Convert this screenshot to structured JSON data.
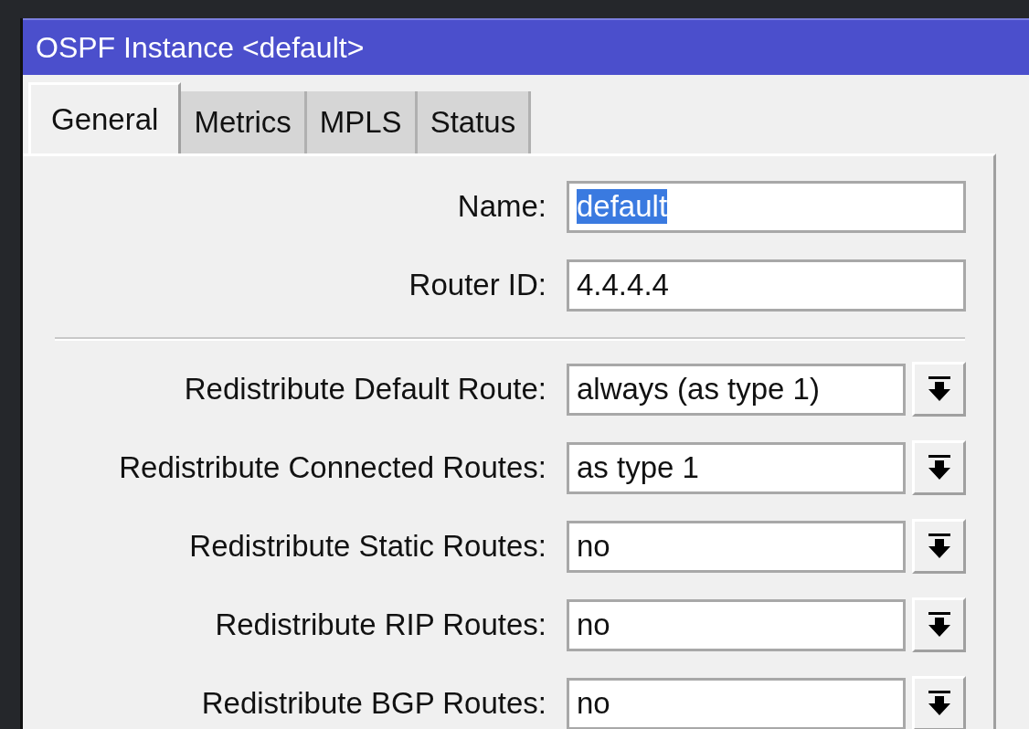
{
  "window": {
    "title": "OSPF Instance <default>"
  },
  "tabs": [
    {
      "label": "General",
      "selected": true
    },
    {
      "label": "Metrics",
      "selected": false
    },
    {
      "label": "MPLS",
      "selected": false
    },
    {
      "label": "Status",
      "selected": false
    }
  ],
  "field_groups": [
    [
      {
        "kind": "text",
        "label": "Name:",
        "value": "default",
        "highlighted": true
      },
      {
        "kind": "text",
        "label": "Router ID:",
        "value": "4.4.4.4",
        "highlighted": false
      }
    ],
    [
      {
        "kind": "dropdown",
        "label": "Redistribute Default Route:",
        "value": "always (as type 1)"
      },
      {
        "kind": "dropdown",
        "label": "Redistribute Connected Routes:",
        "value": "as type 1"
      },
      {
        "kind": "dropdown",
        "label": "Redistribute Static Routes:",
        "value": "no"
      },
      {
        "kind": "dropdown",
        "label": "Redistribute RIP Routes:",
        "value": "no"
      },
      {
        "kind": "dropdown",
        "label": "Redistribute BGP Routes:",
        "value": "no"
      }
    ]
  ]
}
